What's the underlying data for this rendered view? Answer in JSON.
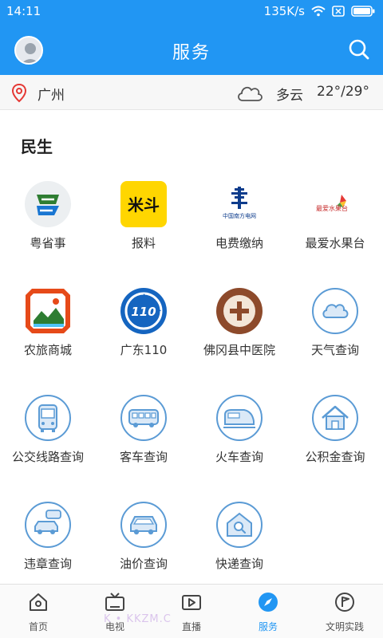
{
  "status": {
    "time": "14:11",
    "speed": "135K/s"
  },
  "header": {
    "title": "服务"
  },
  "weather": {
    "city": "广州",
    "condition": "多云",
    "temperature": "22°/29°"
  },
  "section": {
    "title": "民生"
  },
  "services": [
    {
      "label": "粤省事",
      "icon": "yueshengshi-logo"
    },
    {
      "label": "报料",
      "icon": "baoliao-logo"
    },
    {
      "label": "电费缴纳",
      "icon": "china-southern-power-grid-logo"
    },
    {
      "label": "最爱水果台",
      "icon": "fruit-platform-logo"
    },
    {
      "label": "农旅商城",
      "icon": "agri-tourism-mall-logo"
    },
    {
      "label": "广东110",
      "icon": "guangdong-110-logo"
    },
    {
      "label": "佛冈县中医院",
      "icon": "hospital-logo"
    },
    {
      "label": "天气查询",
      "icon": "cloud-icon"
    },
    {
      "label": "公交线路查询",
      "icon": "bus-icon"
    },
    {
      "label": "客车查询",
      "icon": "coach-icon"
    },
    {
      "label": "火车查询",
      "icon": "train-icon"
    },
    {
      "label": "公积金查询",
      "icon": "house-icon"
    },
    {
      "label": "违章查询",
      "icon": "car-violation-icon"
    },
    {
      "label": "油价查询",
      "icon": "car-icon"
    },
    {
      "label": "快递查询",
      "icon": "package-search-icon"
    }
  ],
  "logo_text": {
    "baoliao": "米斗",
    "power_grid": "中国南方电网",
    "fruit": "最爱水果台",
    "police": "110"
  },
  "tabs": [
    {
      "label": "首页"
    },
    {
      "label": "电视"
    },
    {
      "label": "直播"
    },
    {
      "label": "服务"
    },
    {
      "label": "文明实践"
    }
  ],
  "watermark": "K • KKZM.C",
  "colors": {
    "primary": "#2196f3",
    "icon_ring": "#5b9bd5",
    "icon_fill": "#dbe9f7"
  }
}
